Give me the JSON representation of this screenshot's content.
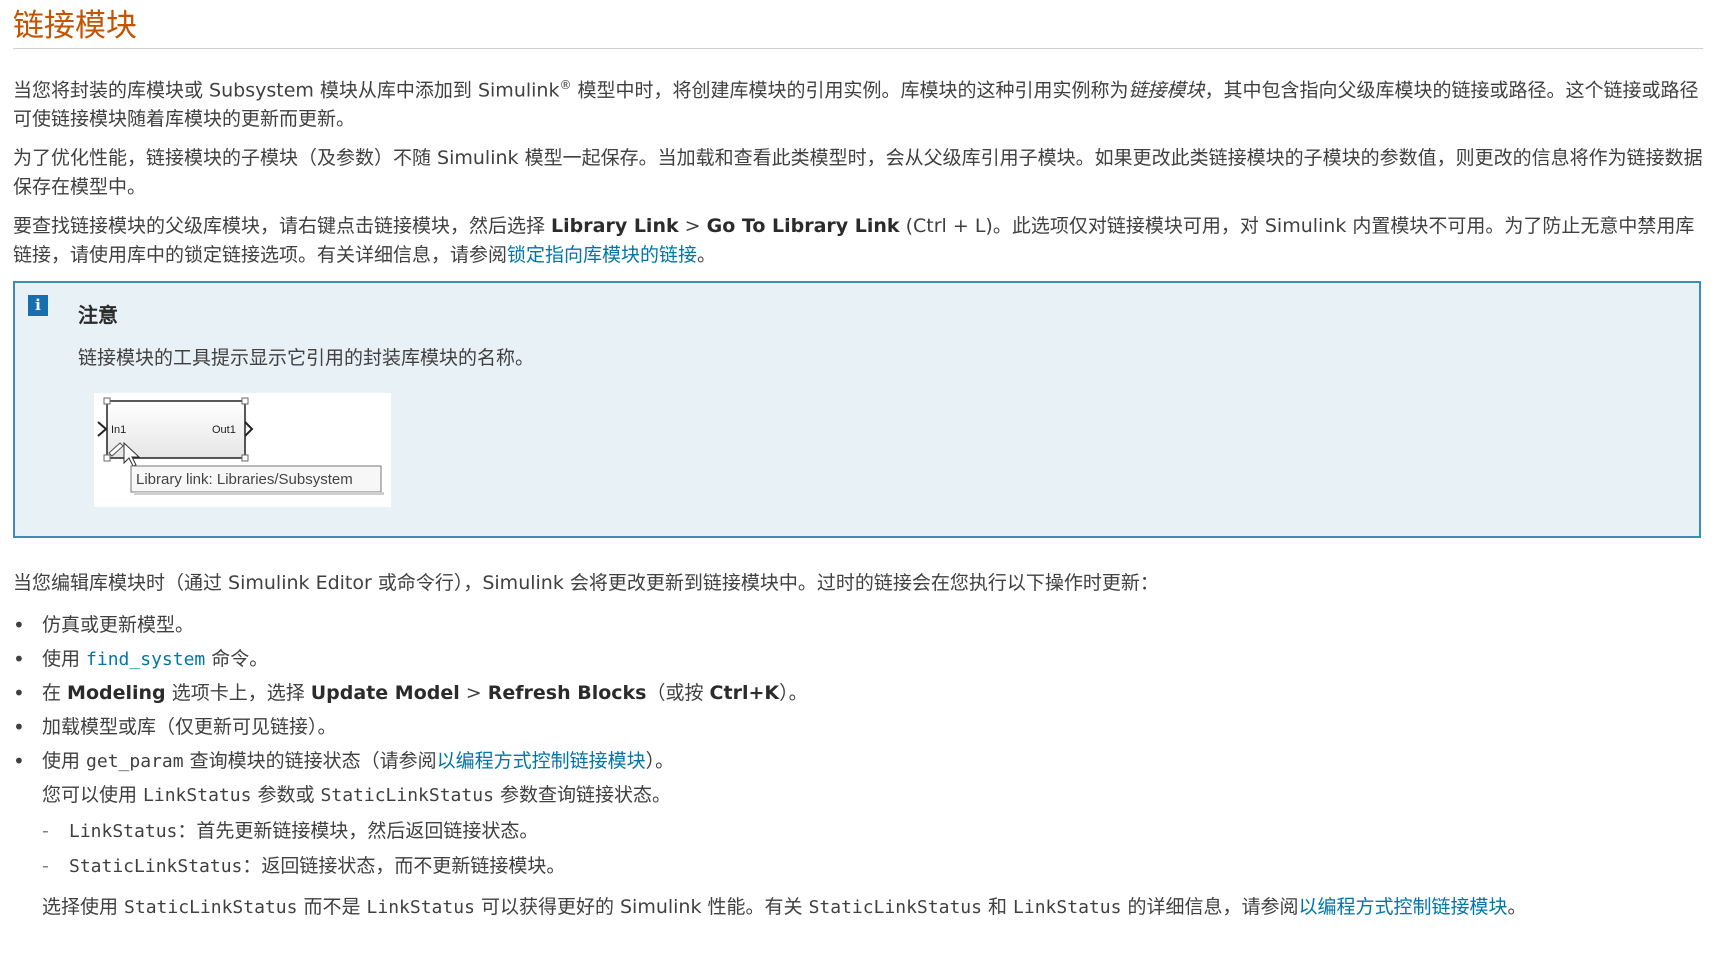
{
  "title": "链接模块",
  "para1": {
    "t1": "当您将封装的库模块或 Subsystem 模块从库中添加到 Simulink",
    "reg": "®",
    "t2": " 模型中时，将创建库模块的引用实例。库模块的这种引用实例称为",
    "em": "链接模块",
    "t3": "，其中包含指向父级库模块的链接或路径。这个链接或路径可使链接模块随着库模块的更新而更新。"
  },
  "para2": "为了优化性能，链接模块的子模块（及参数）不随 Simulink 模型一起保存。当加载和查看此类模型时，会从父级库引用子模块。如果更改此类链接模块的子模块的参数值，则更改的信息将作为链接数据保存在模型中。",
  "para3": {
    "t1": "要查找链接模块的父级库模块，请右键点击链接模块，然后选择 ",
    "b1": "Library Link",
    "gt": " > ",
    "b2": "Go To Library Link",
    "t2": " (Ctrl + L)。此选项仅对链接模块可用，对 Simulink 内置模块不可用。为了防止无意中禁用库链接，请使用库中的锁定链接选项。有关详细信息，请参阅",
    "link": "锁定指向库模块的链接",
    "t3": "。"
  },
  "note": {
    "icon": "info-icon",
    "title": "注意",
    "text": "链接模块的工具提示显示它引用的封装库模块的名称。",
    "block_in": "In1",
    "block_out": "Out1",
    "tooltip": "Library link: Libraries/Subsystem"
  },
  "para4": "当您编辑库模块时（通过 Simulink Editor 或命令行），Simulink 会将更改更新到链接模块中。过时的链接会在您执行以下操作时更新：",
  "bullets": {
    "b1": "仿真或更新模型。",
    "b2_pre": "使用 ",
    "b2_code": "find_system",
    "b2_post": " 命令。",
    "b3_t1": "在 ",
    "b3_b1": "Modeling",
    "b3_t2": " 选项卡上，选择 ",
    "b3_b2": "Update Model",
    "b3_gt": " > ",
    "b3_b3": "Refresh Blocks",
    "b3_t3": "（或按 ",
    "b3_b4": "Ctrl+K",
    "b3_t4": "）。",
    "b4": "加载模型或库（仅更新可见链接）。",
    "b5_pre": "使用 ",
    "b5_code": "get_param",
    "b5_mid": " 查询模块的链接状态（请参阅",
    "b5_link": "以编程方式控制链接模块",
    "b5_post": "）。"
  },
  "sub": {
    "t1": "您可以使用 ",
    "c1": "LinkStatus",
    "t2": " 参数或 ",
    "c2": "StaticLinkStatus",
    "t3": " 参数查询链接状态。",
    "d1_code": "LinkStatus",
    "d1_text": "：首先更新链接模块，然后返回链接状态。",
    "d2_code": "StaticLinkStatus",
    "d2_text": "：返回链接状态，而不更新链接模块。"
  },
  "last": {
    "t1": "选择使用 ",
    "c1": "StaticLinkStatus",
    "t2": " 而不是 ",
    "c2": "LinkStatus",
    "t3": " 可以获得更好的 Simulink 性能。有关 ",
    "c3": "StaticLinkStatus",
    "t4": " 和 ",
    "c4": "LinkStatus",
    "t5": " 的详细信息，请参阅",
    "link": "以编程方式控制链接模块",
    "t6": "。"
  }
}
